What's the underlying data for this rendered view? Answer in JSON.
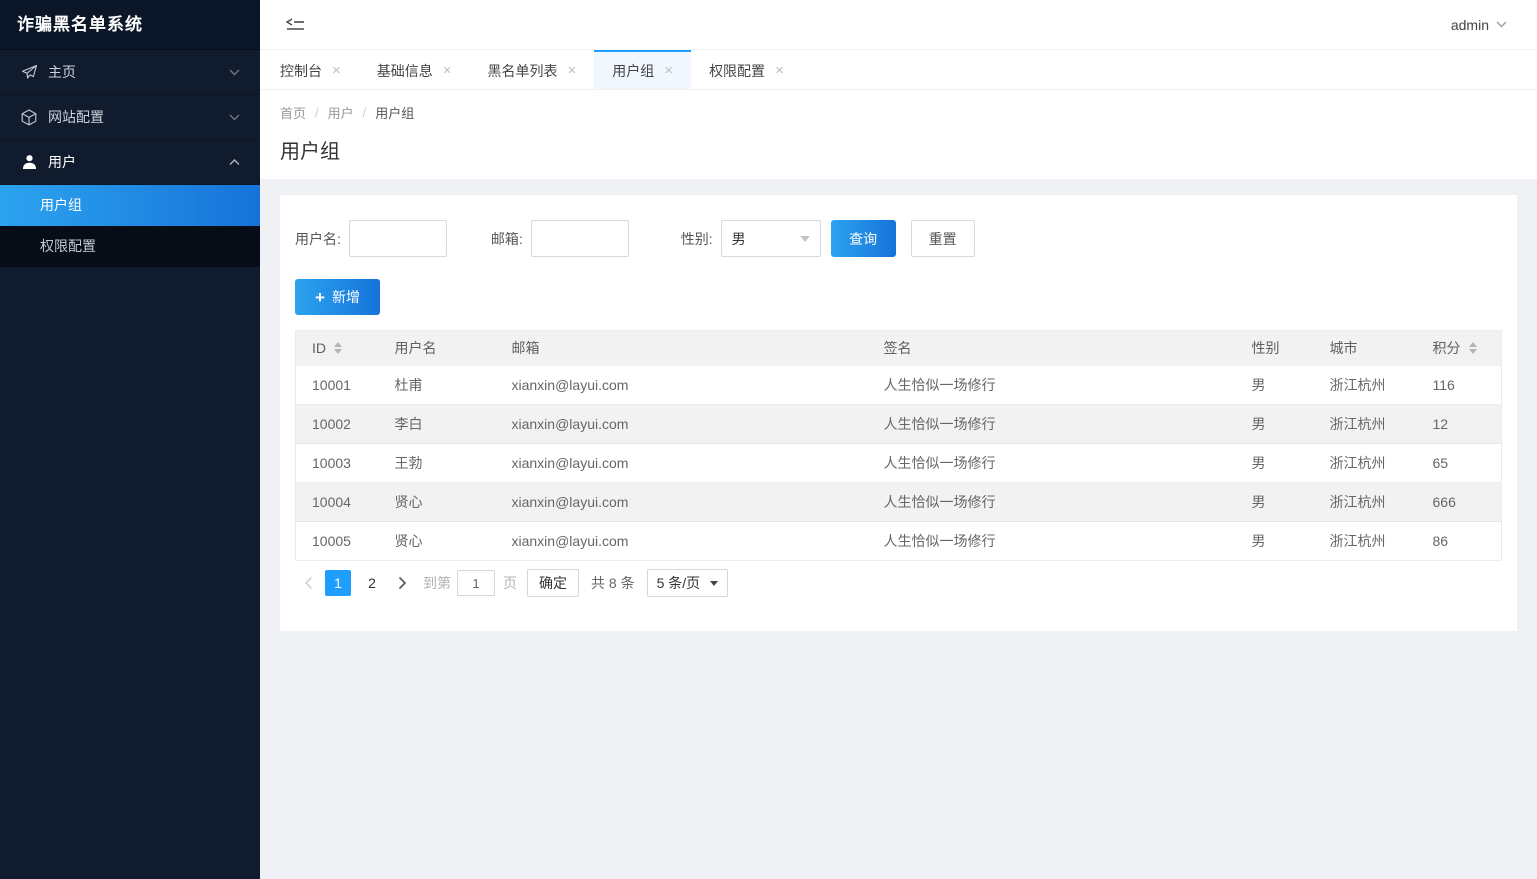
{
  "app": {
    "title": "诈骗黑名单系统",
    "user": "admin"
  },
  "colors": {
    "accent": "#1E9FFF",
    "accent-light": "#2CA3EF",
    "accent-deep": "#1673D9",
    "sidebar-bg": "#101c2e",
    "sidebar-logo-bg": "#0b1728",
    "sidebar-sub-bg": "#070d16"
  },
  "sidebar": {
    "items": [
      {
        "label": "主页",
        "icon": "send-icon",
        "expanded": false
      },
      {
        "label": "网站配置",
        "icon": "cube-icon",
        "expanded": false
      },
      {
        "label": "用户",
        "icon": "user-icon",
        "expanded": true,
        "children": [
          {
            "label": "用户组",
            "active": true
          },
          {
            "label": "权限配置",
            "active": false
          }
        ]
      }
    ]
  },
  "tabs": [
    {
      "label": "控制台",
      "active": false
    },
    {
      "label": "基础信息",
      "active": false
    },
    {
      "label": "黑名单列表",
      "active": false
    },
    {
      "label": "用户组",
      "active": true
    },
    {
      "label": "权限配置",
      "active": false
    }
  ],
  "breadcrumb": {
    "items": [
      "首页",
      "用户",
      "用户组"
    ],
    "separator": "/"
  },
  "page": {
    "title": "用户组"
  },
  "filters": {
    "username_label": "用户名:",
    "email_label": "邮箱:",
    "gender_label": "性别:",
    "gender_value": "男",
    "search_button": "查询",
    "reset_button": "重置",
    "add_button": "新增",
    "plus_glyph": "+"
  },
  "table": {
    "columns": [
      "ID",
      "用户名",
      "邮箱",
      "签名",
      "性别",
      "城市",
      "积分"
    ],
    "rows": [
      [
        "10001",
        "杜甫",
        "xianxin@layui.com",
        "人生恰似一场修行",
        "男",
        "浙江杭州",
        "116"
      ],
      [
        "10002",
        "李白",
        "xianxin@layui.com",
        "人生恰似一场修行",
        "男",
        "浙江杭州",
        "12"
      ],
      [
        "10003",
        "王勃",
        "xianxin@layui.com",
        "人生恰似一场修行",
        "男",
        "浙江杭州",
        "65"
      ],
      [
        "10004",
        "贤心",
        "xianxin@layui.com",
        "人生恰似一场修行",
        "男",
        "浙江杭州",
        "666"
      ],
      [
        "10005",
        "贤心",
        "xianxin@layui.com",
        "人生恰似一场修行",
        "男",
        "浙江杭州",
        "86"
      ]
    ]
  },
  "pagination": {
    "current_page": "1",
    "page2": "2",
    "goto_label": "到第",
    "goto_value": "1",
    "page_unit": "页",
    "confirm_button": "确定",
    "total_text": "共 8 条",
    "per_page": "5 条/页"
  }
}
